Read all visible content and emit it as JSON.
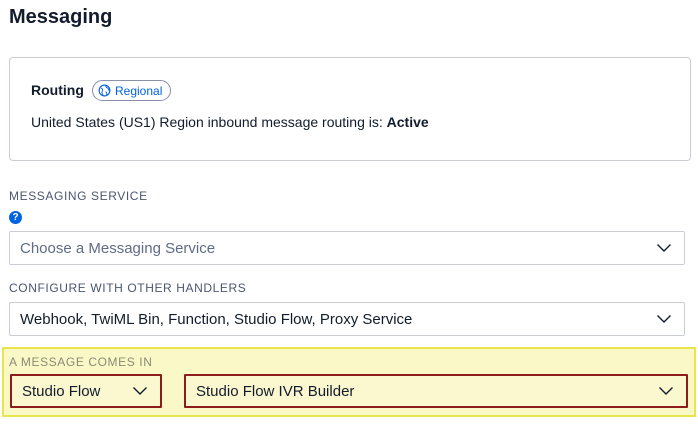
{
  "page": {
    "title": "Messaging"
  },
  "routing": {
    "label": "Routing",
    "badge": "Regional",
    "status_prefix": "United States (US1) Region inbound message routing is: ",
    "status_value": "Active"
  },
  "messaging_service": {
    "label": "MESSAGING SERVICE",
    "help_glyph": "?",
    "placeholder": "Choose a Messaging Service"
  },
  "handlers": {
    "label": "CONFIGURE WITH OTHER HANDLERS",
    "value": "Webhook, TwiML Bin, Function, Studio Flow, Proxy Service"
  },
  "incoming": {
    "label": "A MESSAGE COMES IN",
    "type_value": "Studio Flow",
    "flow_value": "Studio Flow IVR Builder"
  },
  "colors": {
    "accent": "#0263e0",
    "highlight_fill": "#fbf8c8",
    "highlight_border": "#e8e64a",
    "focus_border": "#8b1d1d"
  }
}
